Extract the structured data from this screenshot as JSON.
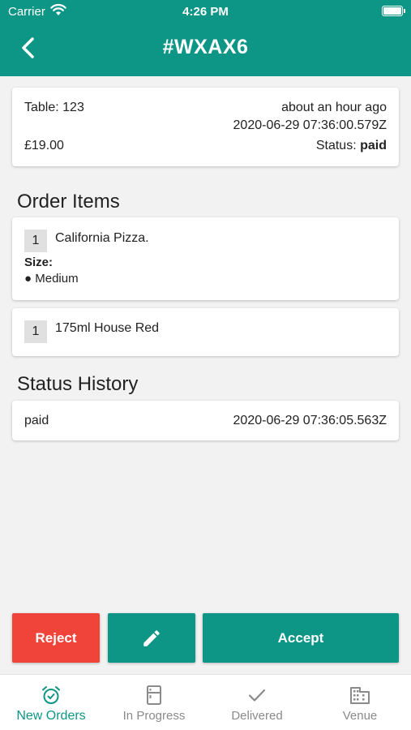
{
  "status_bar": {
    "carrier": "Carrier",
    "time": "4:26 PM"
  },
  "header": {
    "title": "#WXAX6"
  },
  "summary": {
    "table": "Table: 123",
    "relative_time": "about an hour ago",
    "timestamp": "2020-06-29 07:36:00.579Z",
    "price": "£19.00",
    "status_label": "Status:",
    "status_value": "paid"
  },
  "order_items": {
    "title": "Order Items",
    "items": [
      {
        "qty": "1",
        "name": "California Pizza.",
        "option_label": "Size:",
        "option_value": "● Medium"
      },
      {
        "qty": "1",
        "name": "175ml House Red"
      }
    ]
  },
  "status_history": {
    "title": "Status History",
    "entries": [
      {
        "status": "paid",
        "timestamp": "2020-06-29 07:36:05.563Z"
      }
    ]
  },
  "actions": {
    "reject": "Reject",
    "accept": "Accept",
    "edit_icon": "pencil-icon"
  },
  "tabs": [
    {
      "label": "New Orders",
      "icon": "alarm-clock-icon",
      "active": true
    },
    {
      "label": "In Progress",
      "icon": "fridge-icon",
      "active": false
    },
    {
      "label": "Delivered",
      "icon": "check-icon",
      "active": false
    },
    {
      "label": "Venue",
      "icon": "building-icon",
      "active": false
    }
  ],
  "colors": {
    "primary": "#0d9586",
    "danger": "#f0433a",
    "background": "#f2f2f2",
    "tab_inactive": "#8a8a8a"
  }
}
